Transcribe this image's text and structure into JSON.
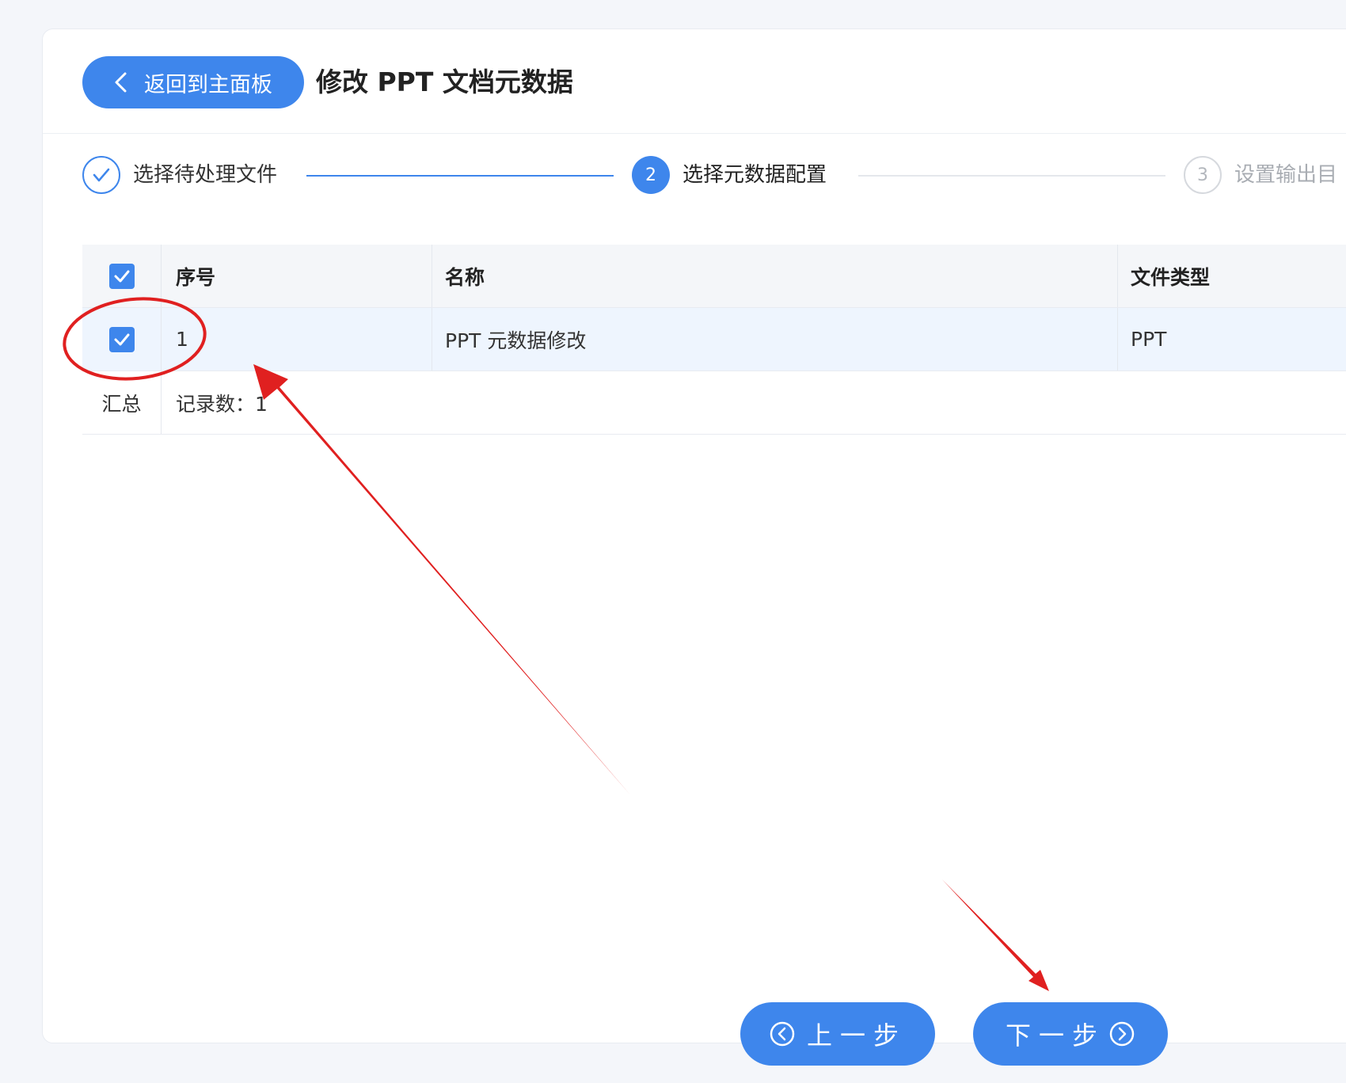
{
  "header": {
    "back_label": "返回到主面板",
    "title": "修改 PPT 文档元数据"
  },
  "steps": [
    {
      "label": "选择待处理文件",
      "state": "done",
      "icon": "check-icon"
    },
    {
      "number": "2",
      "label": "选择元数据配置",
      "state": "active"
    },
    {
      "number": "3",
      "label": "设置输出目",
      "state": "pending"
    }
  ],
  "table": {
    "columns": [
      "序号",
      "名称",
      "文件类型"
    ],
    "rows": [
      {
        "index": "1",
        "name": "PPT 元数据修改",
        "type": "PPT",
        "checked": true
      }
    ],
    "summary_label": "汇总",
    "summary_value": "记录数：1"
  },
  "buttons": {
    "prev_label": "上一步",
    "next_label": "下一步"
  },
  "colors": {
    "primary": "#3e86ec",
    "annotation": "#e02020"
  }
}
